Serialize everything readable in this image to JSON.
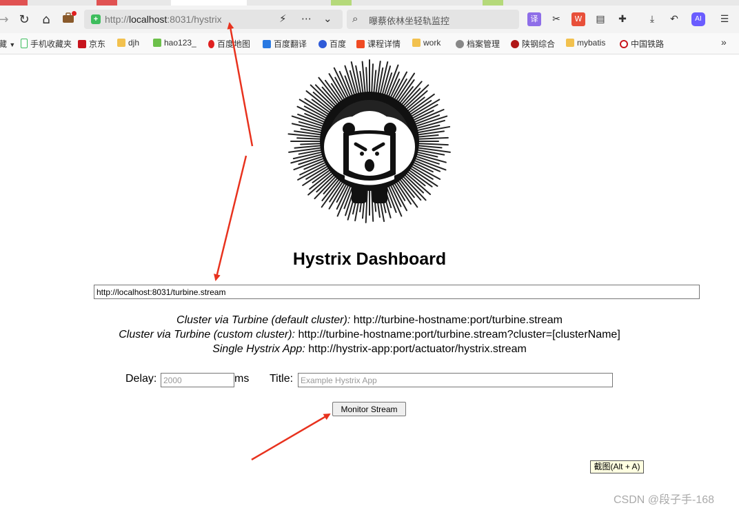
{
  "browser": {
    "url_prefix": "http://",
    "url_host": "localhost",
    "url_rest": ":8031/hystrix",
    "search_text": "曝蔡依林坐轻轨监控"
  },
  "bookmarks": [
    {
      "label": "藏",
      "icon": "dropdown-icon"
    },
    {
      "label": "手机收藏夹",
      "icon": "phone-icon"
    },
    {
      "label": "京东",
      "icon": "jd-icon"
    },
    {
      "label": "djh",
      "icon": "folder-icon"
    },
    {
      "label": "hao123_",
      "icon": "hao123-icon"
    },
    {
      "label": "百度地图",
      "icon": "map-pin-icon"
    },
    {
      "label": "百度翻译",
      "icon": "translate-icon"
    },
    {
      "label": "百度",
      "icon": "baidu-icon"
    },
    {
      "label": "课程详情",
      "icon": "course-icon"
    },
    {
      "label": "work",
      "icon": "folder-icon"
    },
    {
      "label": "档案管理",
      "icon": "globe-icon"
    },
    {
      "label": "陕钢综合",
      "icon": "steel-icon"
    },
    {
      "label": "mybatis",
      "icon": "folder-icon"
    },
    {
      "label": "中国铁路",
      "icon": "railway-icon"
    },
    {
      "label": "»",
      "icon": "more-icon"
    }
  ],
  "dashboard": {
    "title": "Hystrix Dashboard",
    "stream_url": "http://localhost:8031/turbine.stream",
    "hints": [
      {
        "label": "Cluster via Turbine (default cluster):",
        "value": " http://turbine-hostname:port/turbine.stream"
      },
      {
        "label": "Cluster via Turbine (custom cluster):",
        "value": " http://turbine-hostname:port/turbine.stream?cluster=[clusterName]"
      },
      {
        "label": "Single Hystrix App:",
        "value": " http://hystrix-app:port/actuator/hystrix.stream"
      }
    ],
    "delay_label": "Delay:",
    "delay_placeholder": "2000",
    "delay_unit": "ms",
    "title_label": "Title:",
    "title_placeholder": "Example Hystrix App",
    "button_label": "Monitor Stream"
  },
  "tooltip": "截图(Alt + A)",
  "watermark": "CSDN @段子手-168",
  "colors": {
    "arrow": "#e8321e",
    "secure": "#3dbd5d"
  }
}
